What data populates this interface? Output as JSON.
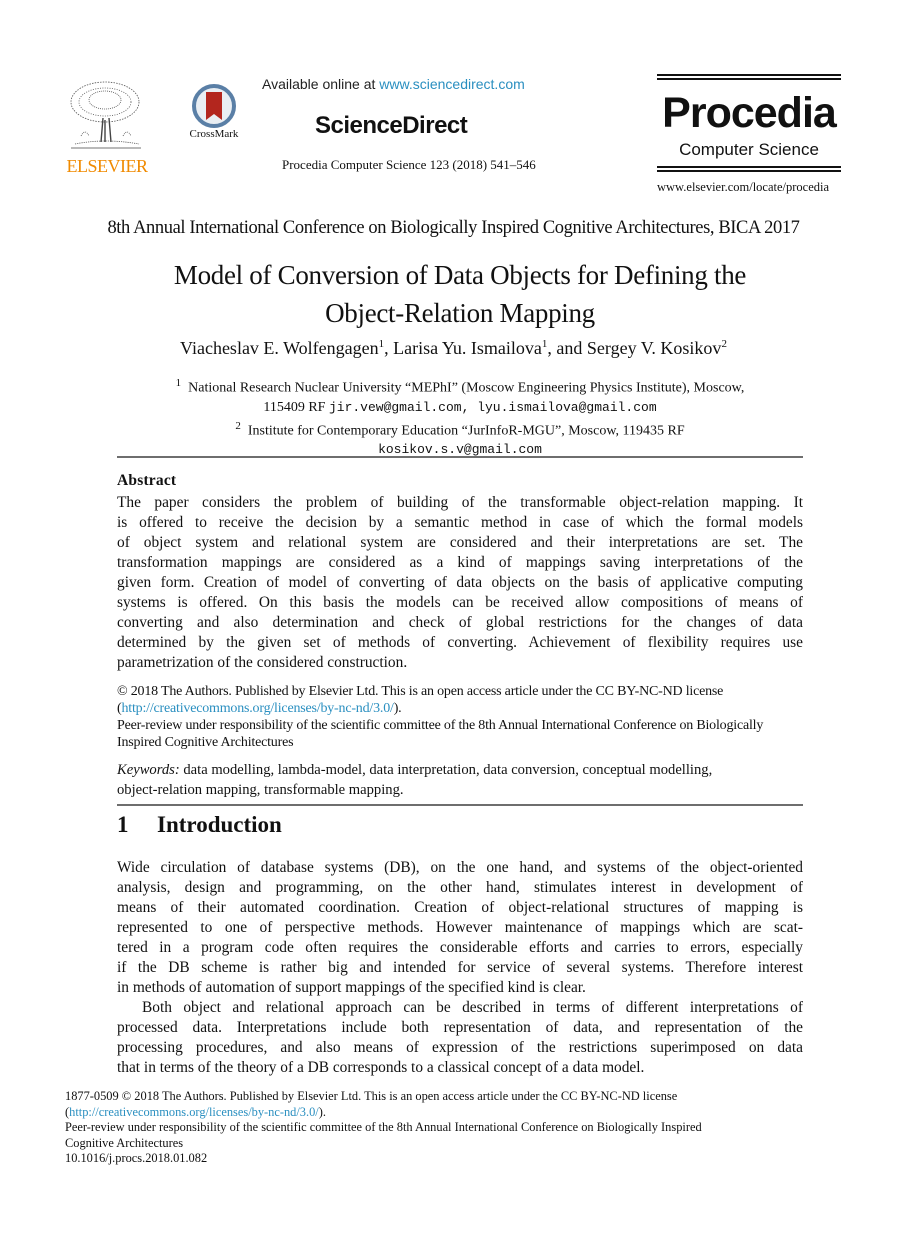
{
  "header": {
    "publisher_logo_text": "ELSEVIER",
    "crossmark_label": "CrossMark",
    "available_prefix": "Available online at ",
    "available_link": "www.sciencedirect.com",
    "platform_name": "ScienceDirect",
    "journal_reference": "Procedia Computer Science 123 (2018) 541–546",
    "journal_brand": "Procedia",
    "journal_subtitle": "Computer Science",
    "journal_url": "www.elsevier.com/locate/procedia"
  },
  "colors": {
    "elsevier_orange": "#f08a00",
    "link_blue": "#2a8fc0",
    "crossmark_ring": "#5a7fa6",
    "crossmark_ribbon": "#b3261e",
    "rule_gray": "#6e6e6e"
  },
  "paper": {
    "conference": "8th Annual International Conference on Biologically Inspired Cognitive Architectures, BICA 2017",
    "title_line1": "Model of Conversion of Data Objects for Defining the",
    "title_line2": "Object-Relation Mapping",
    "authors": [
      {
        "name": "Viacheslav E. Wolfengagen",
        "affil": "1",
        "sep": ", "
      },
      {
        "name": "Larisa Yu. Ismailova",
        "affil": "1",
        "sep": ", and "
      },
      {
        "name": "Sergey V. Kosikov",
        "affil": "2",
        "sep": ""
      }
    ],
    "affiliations": [
      {
        "mark": "1",
        "text": "National Research Nuclear University “MEPhI” (Moscow Engineering Physics Institute), Moscow,",
        "line2_text": "115409 RF",
        "emails": "jir.vew@gmail.com, lyu.ismailova@gmail.com"
      },
      {
        "mark": "2",
        "text": "Institute for Contemporary Education “JurInfoR-MGU”, Moscow, 119435 RF",
        "emails": "kosikov.s.v@gmail.com"
      }
    ],
    "abstract_heading": "Abstract",
    "abstract_lines": [
      "The paper considers the problem of building of the transformable object-relation mapping. It",
      "is offered to receive the decision by a semantic method in case of which the formal models",
      "of object system and relational system are considered and their interpretations are set. The",
      "transformation mappings are considered as a kind of mappings saving interpretations of the",
      "given form. Creation of model of converting of data objects on the basis of applicative computing",
      "systems is offered. On this basis the models can be received allow compositions of means of",
      "converting and also determination and check of global restrictions for the changes of data",
      "determined by the given set of methods of converting. Achievement of flexibility requires use",
      "parametrization of the considered construction."
    ],
    "license": {
      "line1": "© 2018 The Authors. Published by Elsevier Ltd. This is an open access article under the CC BY-NC-ND license",
      "link": "http://creativecommons.org/licenses/by-nc-nd/3.0/",
      "peer_review": "Peer-review under responsibility of the scientific committee of the 8th Annual International Conference on Biologically",
      "peer_review_line2": "Inspired Cognitive Architectures"
    },
    "keywords_label": "Keywords:",
    "keywords_line1": "data modelling, lambda-model, data interpretation, data conversion, conceptual modelling,",
    "keywords_line2": "object-relation mapping, transformable mapping.",
    "section": {
      "number": "1",
      "title": "Introduction"
    },
    "intro_p1_lines": [
      "Wide circulation of database systems (DB), on the one hand, and systems of the object-oriented",
      "analysis, design and programming, on the other hand, stimulates interest in development of",
      "means of their automated coordination. Creation of object-relational structures of mapping is",
      "represented to one of perspective methods. However maintenance of mappings which are scat-",
      "tered in a program code often requires the considerable efforts and carries to errors, especially",
      "if the DB scheme is rather big and intended for service of several systems. Therefore interest",
      "in methods of automation of support mappings of the specified kind is clear."
    ],
    "intro_p2_lines": [
      "Both object and relational approach can be described in terms of different interpretations of",
      "processed data. Interpretations include both representation of data, and representation of the",
      "processing procedures, and also means of expression of the restrictions superimposed on data",
      "that in terms of the theory of a DB corresponds to a classical concept of a data model."
    ]
  },
  "footer": {
    "line1": "1877-0509 © 2018 The Authors. Published by Elsevier Ltd. This is an open access article under the CC BY-NC-ND license",
    "link": "http://creativecommons.org/licenses/by-nc-nd/3.0/",
    "peer_review": "Peer-review under responsibility of the scientific committee of the 8th Annual International Conference on Biologically Inspired",
    "peer_review_line2": "Cognitive Architectures",
    "doi": "10.1016/j.procs.2018.01.082"
  }
}
